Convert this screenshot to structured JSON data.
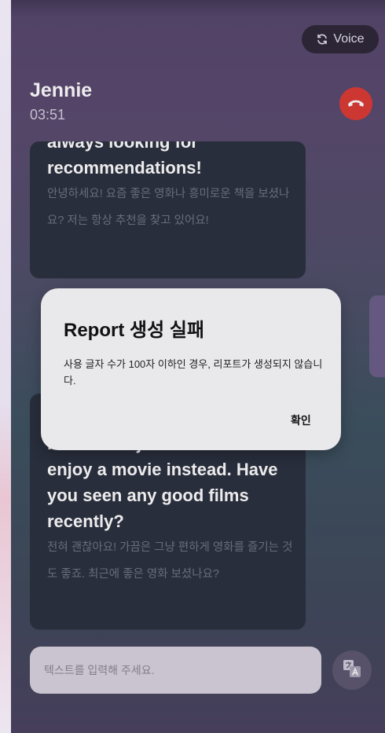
{
  "header": {
    "voice_label": "Voice",
    "caller_name": "Jennie",
    "call_timer": "03:51"
  },
  "messages": [
    {
      "en": "always looking for recommendations!",
      "ko": "안녕하세요! 요즘 좋은 영화나 흥미로운 책을 보셨나요? 저는 항상 추천을 찾고 있어요!"
    },
    {
      "en": "That's totally fine! Sometimes it's nice to just relax and enjoy a movie instead. Have you seen any good films recently?",
      "ko": "전혀 괜찮아요! 가끔은 그냥 편하게 영화를 즐기는 것도 좋죠. 최근에 좋은 영화 보셨나요?"
    }
  ],
  "input": {
    "placeholder": "텍스트를 입력해 주세요."
  },
  "dialog": {
    "title": "Report 생성 실패",
    "message": "사용 글자 수가 100자 이하인 경우, 리포트가 생성되지 않습니다.",
    "confirm_label": "확인"
  },
  "colors": {
    "end_call": "#dd3b35",
    "bubble": "#2b313f",
    "dialog_bg": "#e9e9ec"
  }
}
